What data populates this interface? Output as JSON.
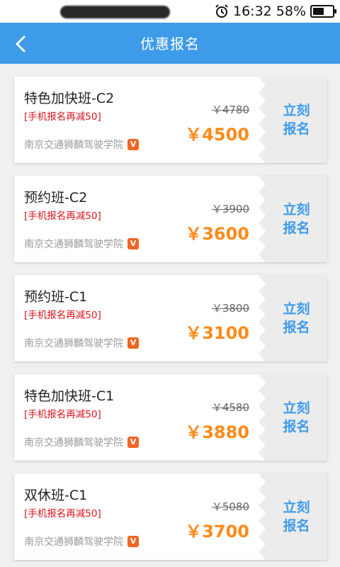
{
  "status_bar": {
    "time": "16:32",
    "battery": "58%",
    "battery_level": 0.58
  },
  "header": {
    "title": "优惠报名"
  },
  "courses": [
    {
      "name": "特色加快班-C2",
      "promo": "[手机报名再减50]",
      "school": "南京交通狮麟驾驶学院",
      "badge": "V",
      "original_price": "￥4780",
      "price": "￥4500",
      "enroll_line1": "立刻",
      "enroll_line2": "报名"
    },
    {
      "name": "预约班-C2",
      "promo": "[手机报名再减50]",
      "school": "南京交通狮麟驾驶学院",
      "badge": "V",
      "original_price": "￥3900",
      "price": "￥3600",
      "enroll_line1": "立刻",
      "enroll_line2": "报名"
    },
    {
      "name": "预约班-C1",
      "promo": "[手机报名再减50]",
      "school": "南京交通狮麟驾驶学院",
      "badge": "V",
      "original_price": "￥3800",
      "price": "￥3100",
      "enroll_line1": "立刻",
      "enroll_line2": "报名"
    },
    {
      "name": "特色加快班-C1",
      "promo": "[手机报名再减50]",
      "school": "南京交通狮麟驾驶学院",
      "badge": "V",
      "original_price": "￥4580",
      "price": "￥3880",
      "enroll_line1": "立刻",
      "enroll_line2": "报名"
    },
    {
      "name": "双休班-C1",
      "promo": "[手机报名再减50]",
      "school": "南京交通狮麟驾驶学院",
      "badge": "V",
      "original_price": "￥5080",
      "price": "￥3700",
      "enroll_line1": "立刻",
      "enroll_line2": "报名"
    }
  ],
  "colors": {
    "primary": "#3d9bea",
    "price": "#ff8a1a",
    "promo": "#d8141c",
    "badge": "#f26522"
  },
  "icons": {
    "back": "chevron-left-icon",
    "alarm": "alarm-icon",
    "battery": "battery-icon",
    "verified": "verified-badge-icon"
  }
}
